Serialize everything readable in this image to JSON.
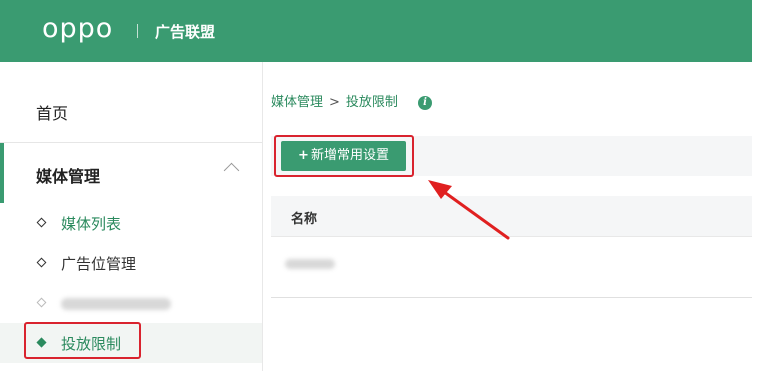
{
  "header": {
    "logo": "oppo",
    "title": "广告联盟",
    "bg_color": "#3a9b71"
  },
  "sidebar": {
    "home": "首页",
    "group": {
      "label": "媒体管理",
      "expanded": true
    },
    "items": [
      {
        "label": "媒体列表",
        "state": "link"
      },
      {
        "label": "广告位管理",
        "state": "normal"
      },
      {
        "label": "",
        "state": "blurred"
      },
      {
        "label": "投放限制",
        "state": "active"
      }
    ]
  },
  "breadcrumb": {
    "parent": "媒体管理",
    "separator": ">",
    "current": "投放限制",
    "info_icon": "i"
  },
  "toolbar": {
    "add_button": "新增常用设置"
  },
  "table": {
    "columns": [
      "名称"
    ]
  },
  "annotations": {
    "highlight_color": "#d9232e"
  }
}
